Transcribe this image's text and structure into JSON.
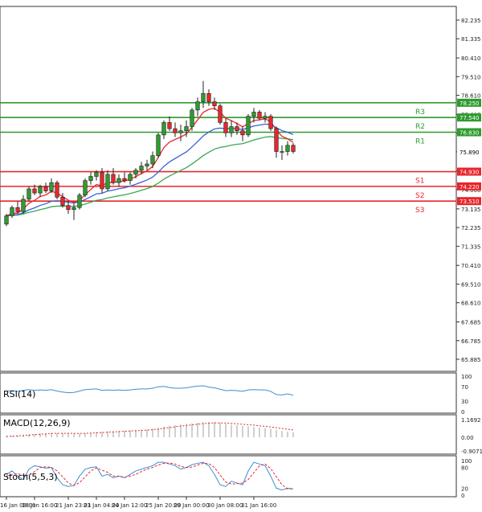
{
  "chart_data": [
    {
      "type": "candlestick",
      "panel": "price",
      "y_ticks": [
        "82.235",
        "81.335",
        "80.410",
        "79.510",
        "78.610",
        "77.685",
        "76.785",
        "75.885",
        "74.960",
        "74.060",
        "73.135",
        "72.235",
        "71.335",
        "70.410",
        "69.510",
        "68.610",
        "67.685",
        "66.785",
        "65.885"
      ],
      "current_price": "75.890",
      "levels": [
        {
          "name": "R3",
          "price": 78.25,
          "label": "78.250",
          "color": "#2e9b2e"
        },
        {
          "name": "R2",
          "price": 77.54,
          "label": "77.540",
          "color": "#2e9b2e"
        },
        {
          "name": "R1",
          "price": 76.83,
          "label": "76.830",
          "color": "#2e9b2e"
        },
        {
          "name": "S1",
          "price": 74.93,
          "label": "74.930",
          "color": "#e8262b"
        },
        {
          "name": "S2",
          "price": 74.22,
          "label": "74.220",
          "color": "#e8262b"
        },
        {
          "name": "S3",
          "price": 73.51,
          "label": "73.510",
          "color": "#e8262b"
        }
      ],
      "ohlc": [
        [
          72.4,
          72.9,
          72.3,
          72.8
        ],
        [
          72.8,
          73.3,
          72.7,
          73.2
        ],
        [
          73.2,
          73.5,
          72.9,
          73.0
        ],
        [
          73.0,
          73.8,
          72.9,
          73.6
        ],
        [
          73.6,
          74.2,
          73.5,
          74.1
        ],
        [
          74.1,
          74.3,
          73.8,
          73.9
        ],
        [
          73.9,
          74.3,
          73.7,
          74.2
        ],
        [
          74.2,
          74.4,
          73.9,
          74.0
        ],
        [
          74.0,
          74.6,
          73.9,
          74.4
        ],
        [
          74.4,
          74.5,
          73.6,
          73.7
        ],
        [
          73.7,
          73.9,
          73.2,
          73.3
        ],
        [
          73.3,
          73.5,
          72.9,
          73.1
        ],
        [
          73.1,
          73.4,
          72.6,
          73.2
        ],
        [
          73.2,
          73.9,
          73.1,
          73.8
        ],
        [
          73.8,
          74.6,
          73.7,
          74.5
        ],
        [
          74.5,
          74.9,
          74.3,
          74.7
        ],
        [
          74.7,
          75.0,
          74.5,
          74.9
        ],
        [
          74.9,
          75.1,
          73.9,
          74.1
        ],
        [
          74.1,
          75.0,
          74.0,
          74.8
        ],
        [
          74.8,
          75.1,
          74.3,
          74.4
        ],
        [
          74.4,
          74.8,
          74.2,
          74.6
        ],
        [
          74.6,
          74.9,
          74.4,
          74.5
        ],
        [
          74.5,
          74.9,
          74.3,
          74.8
        ],
        [
          74.8,
          75.1,
          74.6,
          75.0
        ],
        [
          75.0,
          75.4,
          74.8,
          75.2
        ],
        [
          75.2,
          75.5,
          75.0,
          75.3
        ],
        [
          75.3,
          75.9,
          75.1,
          75.7
        ],
        [
          75.7,
          76.8,
          75.6,
          76.7
        ],
        [
          76.7,
          77.4,
          76.5,
          77.3
        ],
        [
          77.3,
          77.6,
          76.9,
          77.0
        ],
        [
          77.0,
          77.3,
          76.6,
          76.8
        ],
        [
          76.8,
          77.2,
          76.4,
          76.9
        ],
        [
          76.9,
          77.4,
          76.6,
          77.1
        ],
        [
          77.1,
          78.0,
          76.9,
          77.9
        ],
        [
          77.9,
          78.5,
          77.6,
          78.3
        ],
        [
          78.3,
          79.3,
          78.0,
          78.7
        ],
        [
          78.7,
          78.9,
          78.1,
          78.3
        ],
        [
          78.3,
          78.5,
          77.9,
          78.1
        ],
        [
          78.1,
          78.2,
          77.2,
          77.3
        ],
        [
          77.3,
          77.5,
          76.6,
          76.8
        ],
        [
          76.8,
          77.4,
          76.6,
          77.1
        ],
        [
          77.1,
          77.3,
          76.7,
          76.9
        ],
        [
          76.9,
          77.1,
          76.4,
          76.7
        ],
        [
          76.7,
          77.7,
          76.6,
          77.6
        ],
        [
          77.6,
          78.0,
          77.3,
          77.8
        ],
        [
          77.8,
          77.9,
          77.4,
          77.5
        ],
        [
          77.5,
          77.8,
          77.3,
          77.6
        ],
        [
          77.6,
          77.7,
          76.9,
          77.0
        ],
        [
          77.0,
          77.1,
          75.6,
          75.9
        ],
        [
          75.9,
          76.2,
          75.5,
          75.9
        ],
        [
          75.9,
          76.4,
          75.7,
          76.2
        ],
        [
          76.2,
          76.3,
          75.8,
          75.9
        ]
      ],
      "x_ticks": [
        "16 Jan 08:00",
        "18 Jan 16:00",
        "21 Jan 23:01",
        "23 Jan 04:00",
        "24 Jan 12:00",
        "25 Jan 20:00",
        "29 Jan 00:00",
        "30 Jan 08:00",
        "31 Jan 16:00"
      ],
      "x_tick_index": [
        0,
        5,
        11,
        16,
        21,
        27,
        32,
        38,
        44
      ]
    },
    {
      "type": "line",
      "panel": "rsi",
      "title": "RSI(14)",
      "y_ticks": [
        "100",
        "70",
        "30",
        "0"
      ],
      "values": [
        58,
        59,
        57,
        60,
        62,
        60,
        61,
        60,
        62,
        58,
        55,
        53,
        54,
        58,
        62,
        63,
        64,
        60,
        61,
        60,
        61,
        60,
        61,
        63,
        64,
        64,
        66,
        70,
        71,
        68,
        66,
        66,
        67,
        70,
        72,
        73,
        69,
        67,
        63,
        59,
        60,
        59,
        57,
        61,
        62,
        61,
        61,
        57,
        48,
        47,
        50,
        46
      ],
      "color": "#3c8fd6"
    },
    {
      "type": "histogram",
      "panel": "macd",
      "title": "MACD(12,26,9)",
      "y_ticks": [
        "1.1692",
        "0.00",
        "-0.9071"
      ],
      "values": [
        0.08,
        0.1,
        0.12,
        0.15,
        0.2,
        0.22,
        0.25,
        0.27,
        0.3,
        0.28,
        0.26,
        0.24,
        0.22,
        0.24,
        0.27,
        0.3,
        0.34,
        0.36,
        0.38,
        0.4,
        0.42,
        0.44,
        0.46,
        0.48,
        0.5,
        0.52,
        0.56,
        0.62,
        0.7,
        0.76,
        0.8,
        0.84,
        0.88,
        0.92,
        0.96,
        1.0,
        1.02,
        1.0,
        0.96,
        0.9,
        0.85,
        0.8,
        0.76,
        0.72,
        0.68,
        0.64,
        0.6,
        0.55,
        0.48,
        0.42,
        0.37,
        0.32
      ],
      "signal": [
        0.05,
        0.07,
        0.09,
        0.11,
        0.14,
        0.17,
        0.2,
        0.22,
        0.25,
        0.26,
        0.26,
        0.26,
        0.25,
        0.25,
        0.26,
        0.27,
        0.29,
        0.31,
        0.33,
        0.35,
        0.37,
        0.39,
        0.41,
        0.43,
        0.45,
        0.47,
        0.5,
        0.54,
        0.59,
        0.64,
        0.69,
        0.74,
        0.78,
        0.82,
        0.86,
        0.9,
        0.93,
        0.95,
        0.95,
        0.94,
        0.92,
        0.89,
        0.86,
        0.83,
        0.8,
        0.76,
        0.72,
        0.68,
        0.63,
        0.58,
        0.53,
        0.48
      ],
      "bar_color": "#bbbbbb",
      "signal_color": "#e8262b"
    },
    {
      "type": "line",
      "panel": "stoch",
      "title": "Stoch(5,5,3)",
      "y_ticks": [
        "100",
        "80",
        "20",
        "0"
      ],
      "k": [
        60,
        70,
        55,
        45,
        75,
        85,
        82,
        78,
        80,
        50,
        30,
        25,
        28,
        55,
        75,
        80,
        82,
        55,
        60,
        50,
        55,
        50,
        60,
        70,
        75,
        80,
        85,
        95,
        95,
        90,
        85,
        75,
        80,
        88,
        92,
        95,
        85,
        60,
        30,
        25,
        40,
        35,
        30,
        70,
        95,
        90,
        85,
        55,
        20,
        15,
        20,
        18
      ],
      "d": [
        55,
        60,
        62,
        57,
        58,
        68,
        80,
        82,
        80,
        70,
        53,
        35,
        28,
        36,
        53,
        70,
        79,
        72,
        66,
        55,
        55,
        52,
        55,
        60,
        68,
        75,
        80,
        87,
        92,
        93,
        90,
        83,
        80,
        81,
        87,
        92,
        91,
        80,
        58,
        38,
        32,
        33,
        35,
        45,
        65,
        85,
        90,
        77,
        53,
        30,
        18,
        18
      ],
      "k_color": "#3c8fd6",
      "d_color": "#e8262b"
    }
  ]
}
